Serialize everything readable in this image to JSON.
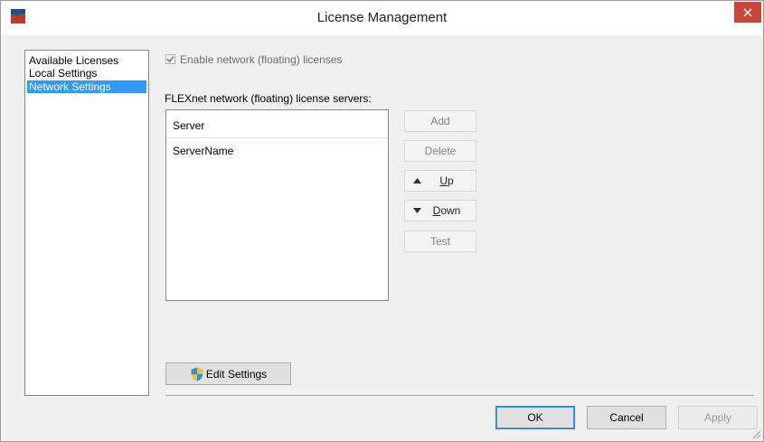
{
  "window": {
    "title": "License Management",
    "close_glyph": "×",
    "app_icon": "license-app-icon"
  },
  "nav": {
    "items": [
      {
        "label": "Available Licenses",
        "selected": false
      },
      {
        "label": "Local Settings",
        "selected": false
      },
      {
        "label": "Network Settings",
        "selected": true
      }
    ]
  },
  "network": {
    "enable_label": "Enable network (floating) licenses",
    "enable_checked": true,
    "servers_label": "FLEXnet network (floating) license servers:",
    "table_header": "Server",
    "servers": [
      "ServerName"
    ]
  },
  "buttons": {
    "add": "Add",
    "delete": "Delete",
    "up_accel": "U",
    "up_rest": "p",
    "down_accel": "D",
    "down_rest": "own",
    "test": "Test",
    "edit_settings": "Edit Settings",
    "ok": "OK",
    "cancel": "Cancel",
    "apply": "Apply"
  },
  "colors": {
    "selection": "#3399ff",
    "close": "#c7483b",
    "window_bg": "#f0f0f0"
  }
}
